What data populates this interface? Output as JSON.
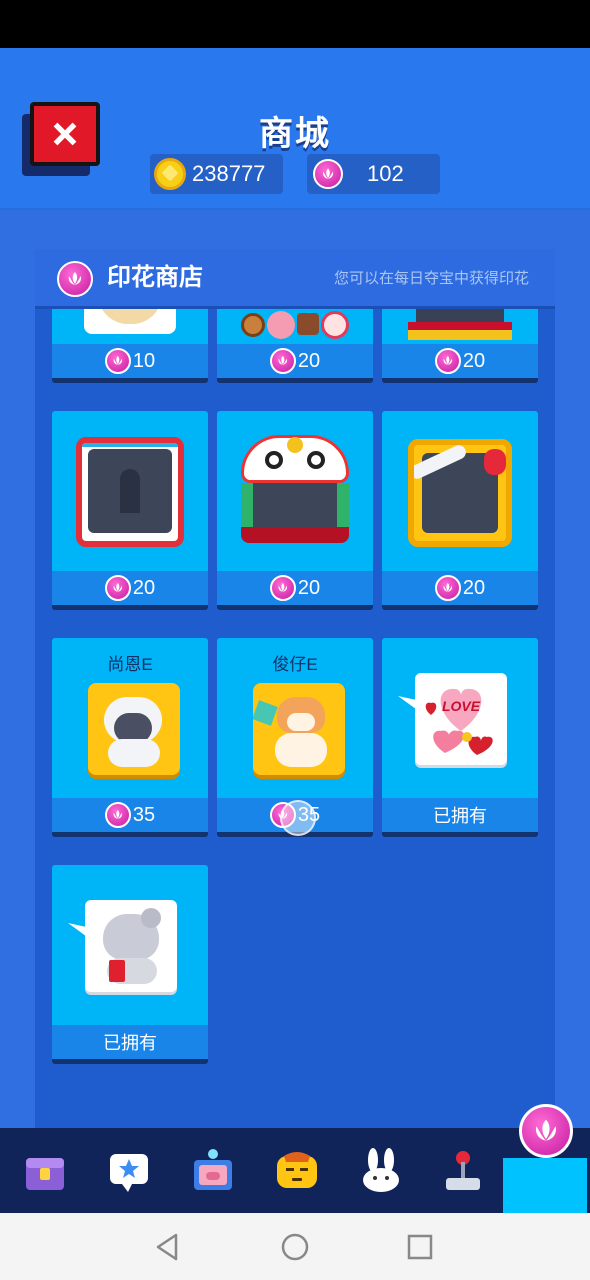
{
  "header": {
    "title": "商城",
    "coins": "238777",
    "stamps": "102"
  },
  "panel": {
    "title": "印花商店",
    "hint": "您可以在每日夺宝中获得印花"
  },
  "items": [
    {
      "price": "10"
    },
    {
      "price": "20"
    },
    {
      "price": "20"
    },
    {
      "price": "20"
    },
    {
      "price": "20"
    },
    {
      "price": "20"
    },
    {
      "name": "尚恩E",
      "price": "35"
    },
    {
      "name": "俊仔E",
      "price": "35"
    },
    {
      "status": "已拥有"
    },
    {
      "status": "已拥有"
    }
  ],
  "colors": {
    "background": "#2f6fe2",
    "card": "#00b4f8",
    "card_bottom": "#1985e8",
    "stamp": "#e22db8",
    "coin": "#f7cf17",
    "close": "#e01827",
    "nav_active": "#00c2ff"
  },
  "icons": {
    "close": "close-icon",
    "coin": "coin-icon",
    "stamp": "lotus-stamp-icon",
    "nav": [
      "chest-icon",
      "star-bubble-icon",
      "pig-robot-icon",
      "emoji-face-icon",
      "bunny-icon",
      "joystick-icon",
      "lotus-stamp-icon"
    ],
    "system": [
      "back-icon",
      "home-icon",
      "recents-icon"
    ]
  }
}
